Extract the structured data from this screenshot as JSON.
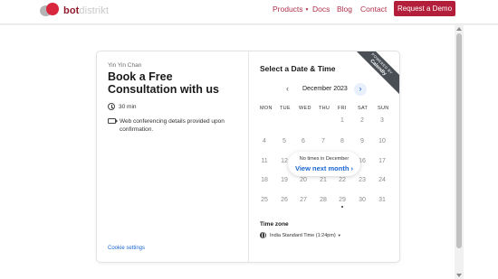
{
  "header": {
    "logo": {
      "part1": "bot",
      "part2": "distrikt"
    },
    "nav": {
      "products": "Products",
      "docs": "Docs",
      "blog": "Blog",
      "contact": "Contact"
    },
    "cta": "Request a Demo"
  },
  "event": {
    "host": "Yin Yin Chan",
    "title": "Book a Free Consultation with us",
    "duration": "30 min",
    "conferencing": "Web conferencing details provided upon confirmation.",
    "cookie_settings": "Cookie settings"
  },
  "badge": {
    "line1": "POWERED BY",
    "line2": "Calendly"
  },
  "calendar": {
    "heading": "Select a Date & Time",
    "month": "December 2023",
    "weekdays": [
      "MON",
      "TUE",
      "WED",
      "THU",
      "FRI",
      "SAT",
      "SUN"
    ],
    "weeks": [
      [
        "",
        "",
        "",
        "",
        "1",
        "2",
        "3"
      ],
      [
        "4",
        "5",
        "6",
        "7",
        "8",
        "9",
        "10"
      ],
      [
        "11",
        "12",
        "13",
        "14",
        "15",
        "16",
        "17"
      ],
      [
        "18",
        "19",
        "20",
        "21",
        "22",
        "23",
        "24"
      ],
      [
        "25",
        "26",
        "27",
        "28",
        "29",
        "30",
        "31"
      ]
    ],
    "today": "29",
    "no_times": "No times in December",
    "view_next": "View next month"
  },
  "timezone": {
    "label": "Time zone",
    "value": "India Standard Time (1:24pm)"
  },
  "colors": {
    "brand": "#b31f3a",
    "link": "#1a66d2"
  }
}
